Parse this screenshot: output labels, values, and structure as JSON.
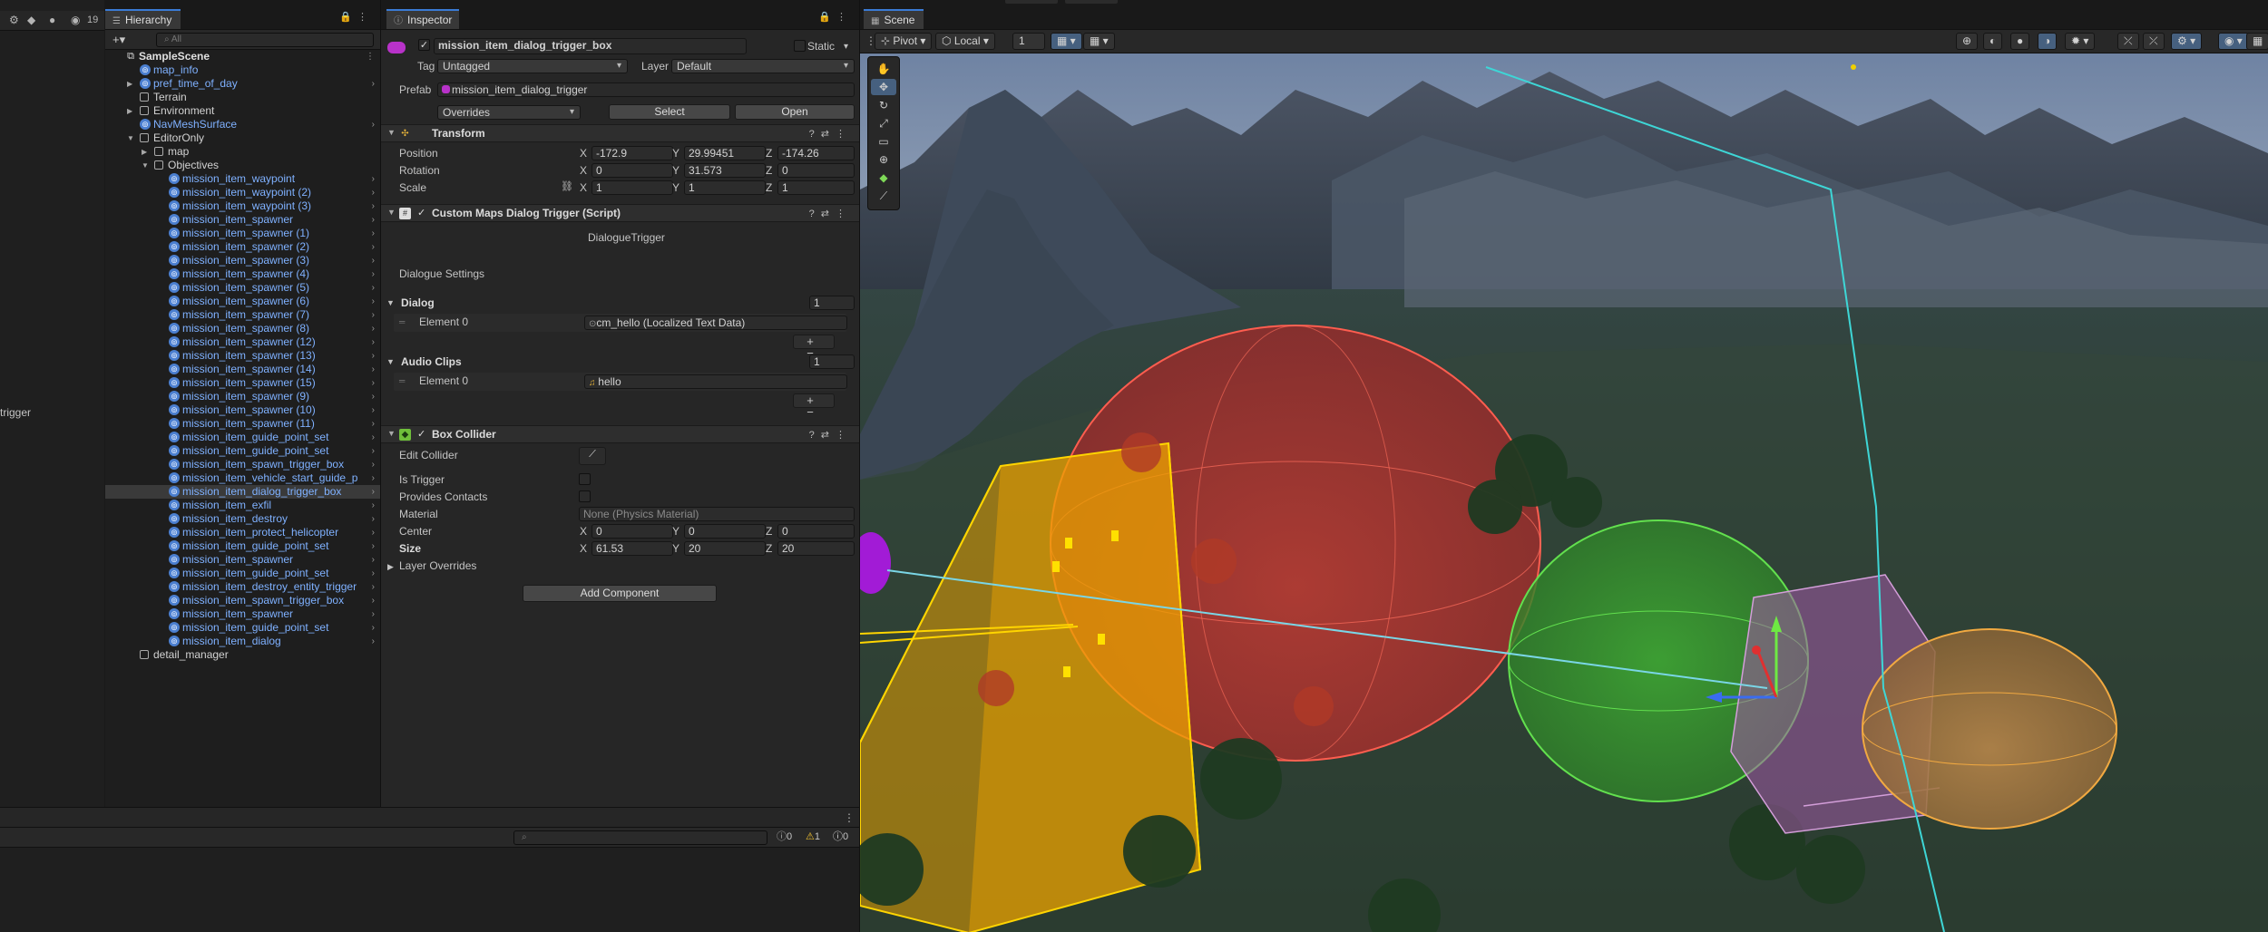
{
  "left_panel": {
    "count": "19",
    "fragment": "trigger"
  },
  "hierarchy": {
    "tab": "Hierarchy",
    "search_placeholder": "All",
    "rows": [
      {
        "label": "SampleScene",
        "depth": 0,
        "type": "scene",
        "expanded": true,
        "style": "bold"
      },
      {
        "label": "map_info",
        "depth": 1,
        "type": "prefab",
        "style": "blue"
      },
      {
        "label": "pref_time_of_day",
        "depth": 1,
        "type": "prefab",
        "style": "blue",
        "arrow": "right",
        "chevron": true
      },
      {
        "label": "Terrain",
        "depth": 1,
        "type": "go",
        "style": "white"
      },
      {
        "label": "Environment",
        "depth": 1,
        "type": "go",
        "style": "white",
        "arrow": "right"
      },
      {
        "label": "NavMeshSurface",
        "depth": 1,
        "type": "prefab",
        "style": "blue",
        "chevron": true
      },
      {
        "label": "EditorOnly",
        "depth": 1,
        "type": "go",
        "style": "white",
        "arrow": "down"
      },
      {
        "label": "map",
        "depth": 2,
        "type": "go",
        "style": "white",
        "arrow": "right"
      },
      {
        "label": "Objectives",
        "depth": 2,
        "type": "go",
        "style": "white",
        "arrow": "down"
      },
      {
        "label": "mission_item_waypoint",
        "depth": 3,
        "type": "prefab",
        "style": "blue",
        "chevron": true
      },
      {
        "label": "mission_item_waypoint (2)",
        "depth": 3,
        "type": "prefab",
        "style": "blue",
        "chevron": true
      },
      {
        "label": "mission_item_waypoint (3)",
        "depth": 3,
        "type": "prefab",
        "style": "blue",
        "chevron": true
      },
      {
        "label": "mission_item_spawner",
        "depth": 3,
        "type": "prefab",
        "style": "blue",
        "chevron": true
      },
      {
        "label": "mission_item_spawner (1)",
        "depth": 3,
        "type": "prefab",
        "style": "blue",
        "chevron": true
      },
      {
        "label": "mission_item_spawner (2)",
        "depth": 3,
        "type": "prefab",
        "style": "blue",
        "chevron": true
      },
      {
        "label": "mission_item_spawner (3)",
        "depth": 3,
        "type": "prefab",
        "style": "blue",
        "chevron": true
      },
      {
        "label": "mission_item_spawner (4)",
        "depth": 3,
        "type": "prefab",
        "style": "blue",
        "chevron": true
      },
      {
        "label": "mission_item_spawner (5)",
        "depth": 3,
        "type": "prefab",
        "style": "blue",
        "chevron": true
      },
      {
        "label": "mission_item_spawner (6)",
        "depth": 3,
        "type": "prefab",
        "style": "blue",
        "chevron": true
      },
      {
        "label": "mission_item_spawner (7)",
        "depth": 3,
        "type": "prefab",
        "style": "blue",
        "chevron": true
      },
      {
        "label": "mission_item_spawner (8)",
        "depth": 3,
        "type": "prefab",
        "style": "blue",
        "chevron": true
      },
      {
        "label": "mission_item_spawner (12)",
        "depth": 3,
        "type": "prefab",
        "style": "blue",
        "chevron": true
      },
      {
        "label": "mission_item_spawner (13)",
        "depth": 3,
        "type": "prefab",
        "style": "blue",
        "chevron": true
      },
      {
        "label": "mission_item_spawner (14)",
        "depth": 3,
        "type": "prefab",
        "style": "blue",
        "chevron": true
      },
      {
        "label": "mission_item_spawner (15)",
        "depth": 3,
        "type": "prefab",
        "style": "blue",
        "chevron": true
      },
      {
        "label": "mission_item_spawner (9)",
        "depth": 3,
        "type": "prefab",
        "style": "blue",
        "chevron": true
      },
      {
        "label": "mission_item_spawner (10)",
        "depth": 3,
        "type": "prefab",
        "style": "blue",
        "chevron": true
      },
      {
        "label": "mission_item_spawner (11)",
        "depth": 3,
        "type": "prefab",
        "style": "blue",
        "chevron": true
      },
      {
        "label": "mission_item_guide_point_set",
        "depth": 3,
        "type": "prefab",
        "style": "blue",
        "chevron": true
      },
      {
        "label": "mission_item_guide_point_set",
        "depth": 3,
        "type": "prefab",
        "style": "blue",
        "chevron": true
      },
      {
        "label": "mission_item_spawn_trigger_box",
        "depth": 3,
        "type": "prefab",
        "style": "blue",
        "chevron": true
      },
      {
        "label": "mission_item_vehicle_start_guide_p",
        "depth": 3,
        "type": "prefab",
        "style": "blue",
        "chevron": true
      },
      {
        "label": "mission_item_dialog_trigger_box",
        "depth": 3,
        "type": "prefab",
        "style": "blue",
        "chevron": true,
        "selected": true
      },
      {
        "label": "mission_item_exfil",
        "depth": 3,
        "type": "prefab",
        "style": "blue",
        "chevron": true
      },
      {
        "label": "mission_item_destroy",
        "depth": 3,
        "type": "prefab",
        "style": "blue",
        "chevron": true
      },
      {
        "label": "mission_item_protect_helicopter",
        "depth": 3,
        "type": "prefab",
        "style": "blue",
        "chevron": true
      },
      {
        "label": "mission_item_guide_point_set",
        "depth": 3,
        "type": "prefab",
        "style": "blue",
        "chevron": true
      },
      {
        "label": "mission_item_spawner",
        "depth": 3,
        "type": "prefab",
        "style": "blue",
        "chevron": true
      },
      {
        "label": "mission_item_guide_point_set",
        "depth": 3,
        "type": "prefab",
        "style": "blue",
        "chevron": true
      },
      {
        "label": "mission_item_destroy_entity_trigger",
        "depth": 3,
        "type": "prefab",
        "style": "blue",
        "chevron": true
      },
      {
        "label": "mission_item_spawn_trigger_box",
        "depth": 3,
        "type": "prefab",
        "style": "blue",
        "chevron": true
      },
      {
        "label": "mission_item_spawner",
        "depth": 3,
        "type": "prefab",
        "style": "blue",
        "chevron": true
      },
      {
        "label": "mission_item_guide_point_set",
        "depth": 3,
        "type": "prefab",
        "style": "blue",
        "chevron": true
      },
      {
        "label": "mission_item_dialog",
        "depth": 3,
        "type": "prefab",
        "style": "blue",
        "chevron": true
      },
      {
        "label": "detail_manager",
        "depth": 1,
        "type": "go",
        "style": "white"
      }
    ]
  },
  "inspector": {
    "tab": "Inspector",
    "object_name": "mission_item_dialog_trigger_box",
    "static_label": "Static",
    "tag_label": "Tag",
    "tag_value": "Untagged",
    "layer_label": "Layer",
    "layer_value": "Default",
    "prefab_label": "Prefab",
    "prefab_value": "mission_item_dialog_trigger",
    "overrides_label": "Overrides",
    "select_label": "Select",
    "open_label": "Open",
    "transform": {
      "title": "Transform",
      "position_label": "Position",
      "rotation_label": "Rotation",
      "scale_label": "Scale",
      "position": {
        "x": "-172.9",
        "y": "29.99451",
        "z": "-174.26"
      },
      "rotation": {
        "x": "0",
        "y": "31.573",
        "z": "0"
      },
      "scale": {
        "x": "1",
        "y": "1",
        "z": "1"
      }
    },
    "script": {
      "title": "Custom Maps Dialog Trigger (Script)",
      "class_name": "DialogueTrigger",
      "settings_label": "Dialogue Settings",
      "dialog_label": "Dialog",
      "dialog_count": "1",
      "element0_label": "Element 0",
      "dialog_element0": "cm_hello (Localized Text Data)",
      "audio_label": "Audio Clips",
      "audio_count": "1",
      "audio_element0": "hello"
    },
    "collider": {
      "title": "Box Collider",
      "edit_label": "Edit Collider",
      "is_trigger_label": "Is Trigger",
      "provides_contacts_label": "Provides Contacts",
      "material_label": "Material",
      "material_value": "None (Physics Material)",
      "center_label": "Center",
      "size_label": "Size",
      "center": {
        "x": "0",
        "y": "0",
        "z": "0"
      },
      "size": {
        "x": "61.53",
        "y": "20",
        "z": "20"
      },
      "layer_overrides_label": "Layer Overrides"
    },
    "add_component_label": "Add Component",
    "axis_x": "X",
    "axis_y": "Y",
    "axis_z": "Z"
  },
  "scene": {
    "tab": "Scene",
    "pivot_label": "Pivot",
    "local_label": "Local",
    "grid_value": "1"
  },
  "console": {
    "log_count": "0",
    "warn_count": "1",
    "error_count": "0"
  },
  "colors": {
    "accent": "#3a7bd5",
    "prefab_blue": "#7fb1ff",
    "collider_yellow": "#f5d000"
  }
}
